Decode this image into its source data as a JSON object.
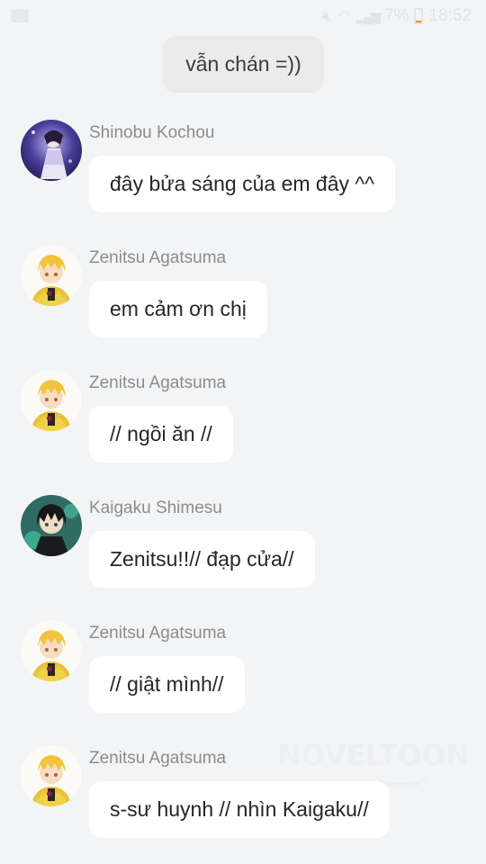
{
  "status_bar": {
    "battery": "7%",
    "time": "18:52",
    "icons": [
      "image-icon",
      "mute-icon",
      "wifi-icon",
      "signal-icon",
      "battery-icon"
    ]
  },
  "system_message": "vẫn chán =))",
  "messages": [
    {
      "sender": "Shinobu Kochou",
      "text": "đây bửa sáng của em đây ^^",
      "avatar": "shinobu-avatar"
    },
    {
      "sender": "Zenitsu Agatsuma",
      "text": "em cảm ơn chị",
      "avatar": "zenitsu-avatar"
    },
    {
      "sender": "Zenitsu Agatsuma",
      "text": "// ngồi ăn //",
      "avatar": "zenitsu-avatar"
    },
    {
      "sender": "Kaigaku Shimesu",
      "text": "Zenitsu!!// đạp cửa//",
      "avatar": "kaigaku-avatar"
    },
    {
      "sender": "Zenitsu Agatsuma",
      "text": "// giật mình//",
      "avatar": "zenitsu-avatar"
    },
    {
      "sender": "Zenitsu Agatsuma",
      "text": "s-sư huynh // nhìn Kaigaku//",
      "avatar": "zenitsu-avatar"
    }
  ],
  "watermark": "NOVELTOON",
  "colors": {
    "background": "#f3f4f6",
    "bubble": "#ffffff",
    "system_bubble": "#ebebeb",
    "sender_text": "#8c8c8c",
    "message_text": "#262626"
  }
}
